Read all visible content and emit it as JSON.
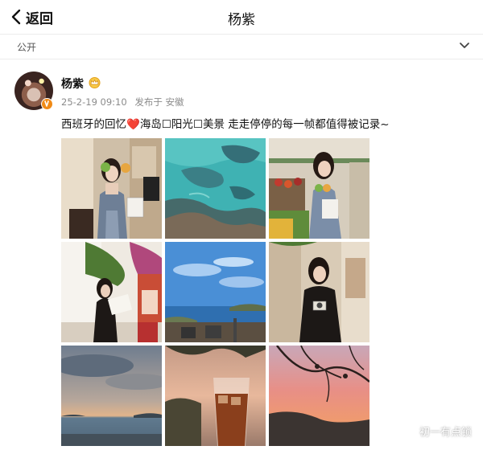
{
  "nav": {
    "back_label": "返回",
    "title": "杨紫"
  },
  "visibility": {
    "label": "公开"
  },
  "post": {
    "author": "杨紫",
    "timestamp": "25-2-19 09:10",
    "source": "发布于 安徽",
    "caption_before": "西班牙的回忆",
    "caption_emoji": "❤️",
    "caption_after": "海岛☐阳光☐美景 走走停停的每一帧都值得被记录~"
  },
  "watermark": {
    "text": "初一有点锁"
  },
  "icons": {
    "back": "chevron-left-icon",
    "visibility": "chevron-down-icon",
    "badge": "crown-icon",
    "verified": "verified-badge-icon",
    "watermark": "logo-icon"
  },
  "colors": {
    "heart": "#e23b3b",
    "badge": "#f08a16",
    "meta": "#8b8b8b"
  },
  "photos": [
    "woman-holding-fruit-photo",
    "turquoise-sea-rocks-photo",
    "woman-at-fruit-stand-photo",
    "woman-reading-menu-photo",
    "coastline-blue-sky-photo",
    "woman-with-camera-photo",
    "sunset-over-sea-photo",
    "iced-drink-photo",
    "sunset-through-branches-photo"
  ]
}
